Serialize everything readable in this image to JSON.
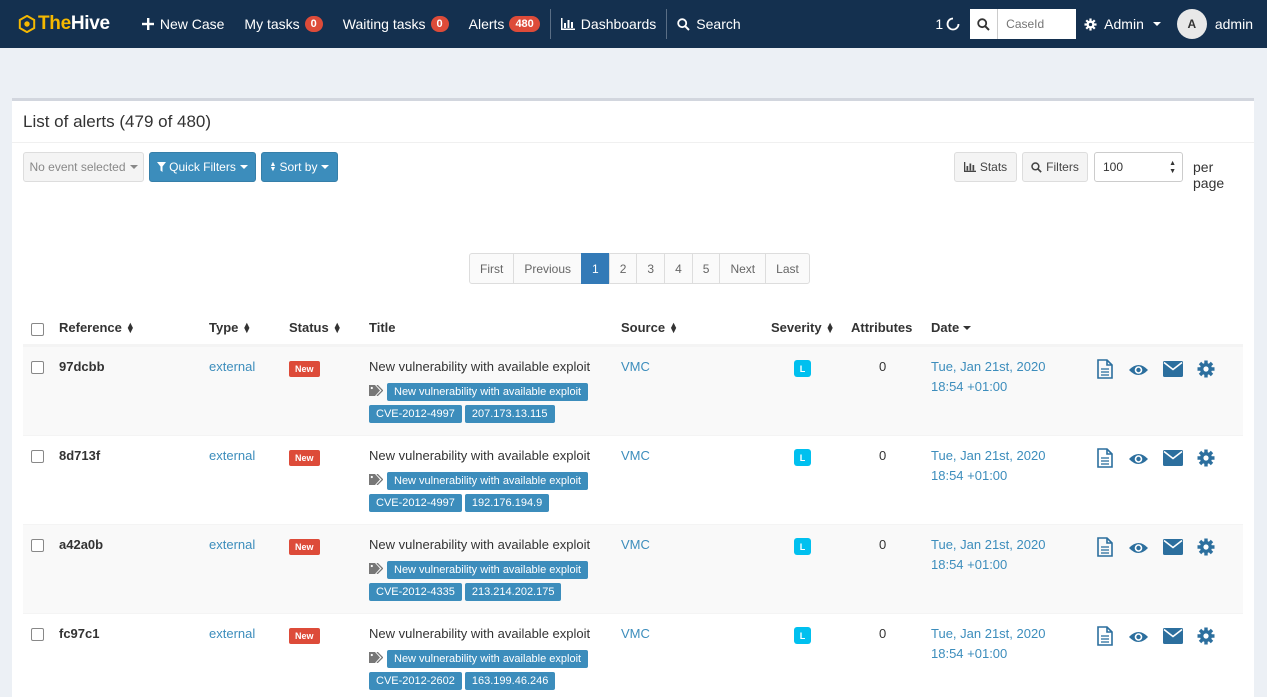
{
  "brand": {
    "part1": "The",
    "part2": "Hive"
  },
  "nav": {
    "new_case": "New Case",
    "my_tasks": "My tasks",
    "my_tasks_count": "0",
    "waiting_tasks": "Waiting tasks",
    "waiting_tasks_count": "0",
    "alerts": "Alerts",
    "alerts_count": "480",
    "dashboards": "Dashboards",
    "search": "Search",
    "activity_count": "1",
    "caseid_placeholder": "CaseId",
    "admin_menu": "Admin",
    "avatar_initial": "A",
    "user": "admin"
  },
  "panel": {
    "title": "List of alerts (479 of 480)"
  },
  "toolbar": {
    "event_select": "No event selected",
    "quick_filters": "Quick Filters",
    "sort_by": "Sort by",
    "stats": "Stats",
    "filters": "Filters",
    "page_size": "100",
    "per_page": "per page"
  },
  "pagination": [
    "First",
    "Previous",
    "1",
    "2",
    "3",
    "4",
    "5",
    "Next",
    "Last"
  ],
  "pagination_active": "1",
  "columns": {
    "reference": "Reference",
    "type": "Type",
    "status": "Status",
    "title": "Title",
    "source": "Source",
    "severity": "Severity",
    "attributes": "Attributes",
    "date": "Date"
  },
  "rows": [
    {
      "reference": "97dcbb",
      "type": "external",
      "status": "New",
      "title": "New vulnerability with available exploit",
      "tags": [
        "New vulnerability with available exploit",
        "CVE-2012-4997",
        "207.173.13.115"
      ],
      "source": "VMC",
      "severity": "L",
      "attributes": "0",
      "date1": "Tue, Jan 21st, 2020",
      "date2": "18:54 +01:00"
    },
    {
      "reference": "8d713f",
      "type": "external",
      "status": "New",
      "title": "New vulnerability with available exploit",
      "tags": [
        "New vulnerability with available exploit",
        "CVE-2012-4997",
        "192.176.194.9"
      ],
      "source": "VMC",
      "severity": "L",
      "attributes": "0",
      "date1": "Tue, Jan 21st, 2020",
      "date2": "18:54 +01:00"
    },
    {
      "reference": "a42a0b",
      "type": "external",
      "status": "New",
      "title": "New vulnerability with available exploit",
      "tags": [
        "New vulnerability with available exploit",
        "CVE-2012-4335",
        "213.214.202.175"
      ],
      "source": "VMC",
      "severity": "L",
      "attributes": "0",
      "date1": "Tue, Jan 21st, 2020",
      "date2": "18:54 +01:00"
    },
    {
      "reference": "fc97c1",
      "type": "external",
      "status": "New",
      "title": "New vulnerability with available exploit",
      "tags": [
        "New vulnerability with available exploit",
        "CVE-2012-2602",
        "163.199.46.246"
      ],
      "source": "VMC",
      "severity": "L",
      "attributes": "0",
      "date1": "Tue, Jan 21st, 2020",
      "date2": "18:54 +01:00"
    }
  ],
  "colors": {
    "navbar": "#14304f",
    "primary": "#3c8dbc",
    "danger": "#dd4b39",
    "info": "#00c0ef",
    "brand_yellow": "#f5b800"
  },
  "icons": {
    "row_actions": [
      "file-icon",
      "eye-icon",
      "envelope-icon",
      "gear-icon"
    ]
  }
}
